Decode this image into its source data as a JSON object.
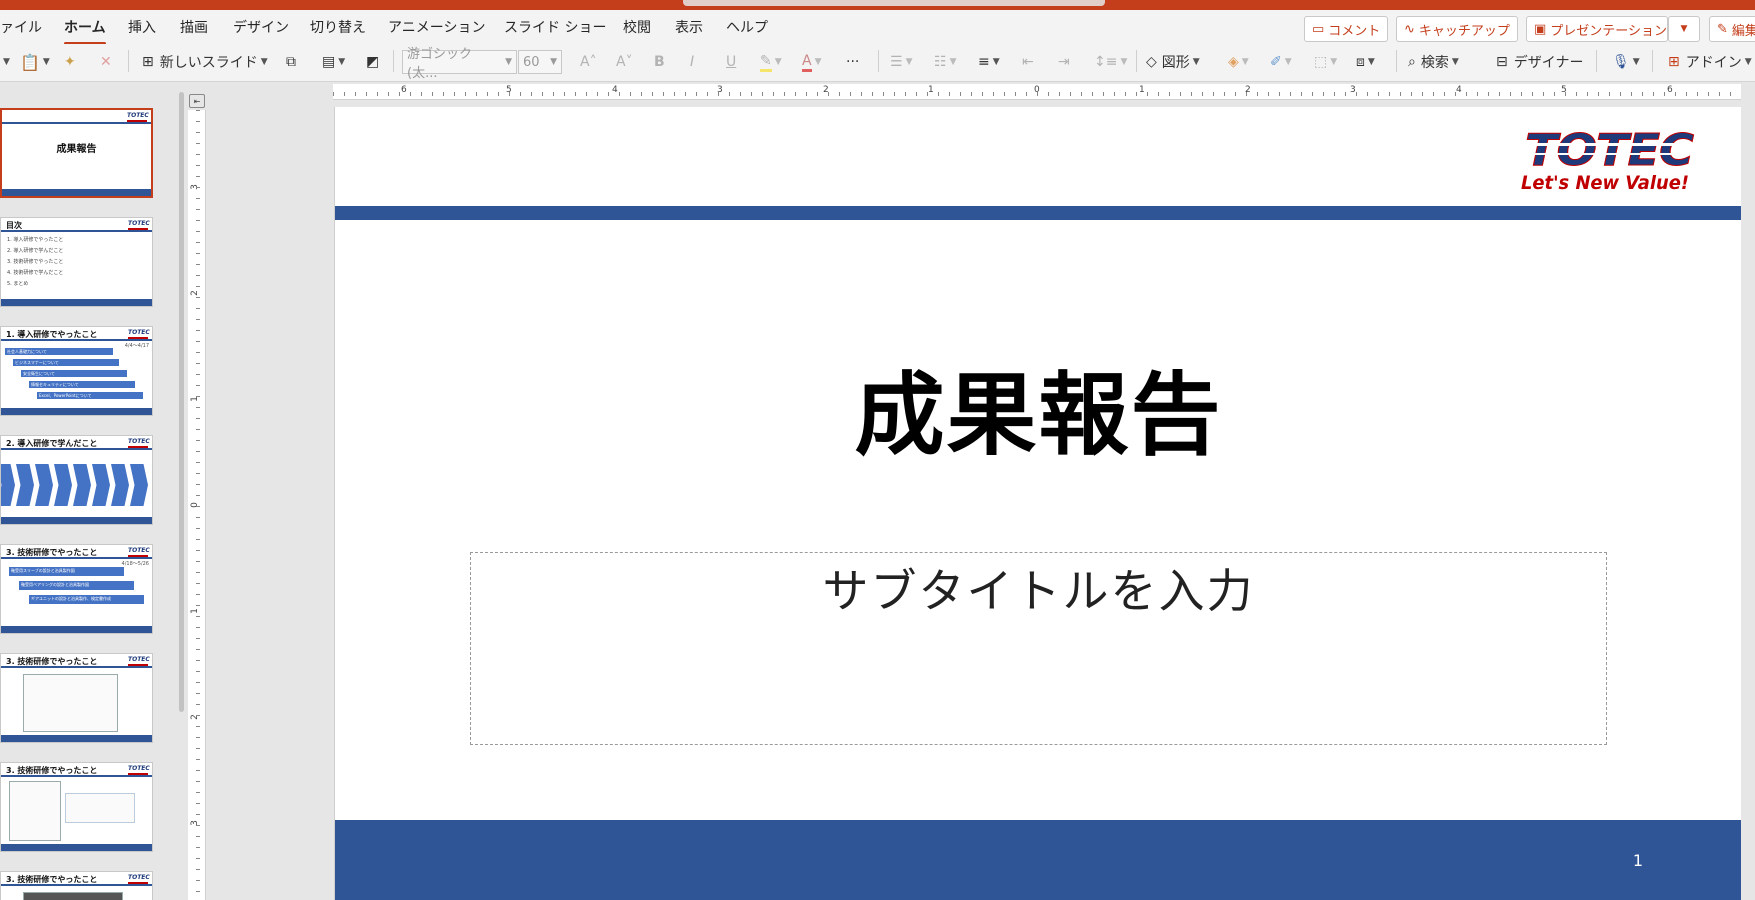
{
  "menu": {
    "tabs": [
      "ァイル",
      "ホーム",
      "挿入",
      "描画",
      "デザイン",
      "切り替え",
      "アニメーション",
      "スライド ショー",
      "校閲",
      "表示",
      "ヘルプ"
    ],
    "active_tab": "ホーム",
    "comment_label": "コメント",
    "catchup_label": "キャッチアップ",
    "present_label": "プレゼンテーション",
    "edit_label": "編集"
  },
  "ribbon": {
    "new_slide_label": "新しいスライド",
    "font_name": "游ゴシック (太...",
    "font_size": "60",
    "search_label": "検索",
    "shapes_label": "図形",
    "designer_label": "デザイナー",
    "addins_label": "アドイン",
    "more": "···"
  },
  "ruler": {
    "h_labels": [
      "6",
      "5",
      "4",
      "3",
      "2",
      "1",
      "0",
      "1",
      "2",
      "3",
      "4",
      "5",
      "6"
    ],
    "v_labels": [
      "3",
      "2",
      "1",
      "0",
      "1",
      "2",
      "3"
    ]
  },
  "slide": {
    "title": "成果報告",
    "subtitle_placeholder": "サブタイトルを入力",
    "page_number": "1",
    "logo_text": "TOTEC",
    "logo_tagline": "Let's New Value!"
  },
  "thumbnails": {
    "t1_title": "成果報告",
    "t2_title": "目次",
    "t2_items": [
      "1. 導入研修でやったこと",
      "2. 導入研修で学んだこと",
      "3. 技術研修でやったこと",
      "4. 技術研修で学んだこと",
      "5. まとめ"
    ],
    "t3_title": "1. 導入研修でやったこと",
    "t3_date": "4/4～4/17",
    "t3_items": [
      "社会人基礎力について",
      "ビジネスマナーについて",
      "安全衛生について",
      "情報セキュリティについて",
      "Excel、PowerPointについて"
    ],
    "t4_title": "2. 導入研修で学んだこと",
    "t4_items": [
      "社会人基礎力",
      "報連相",
      "挨拶",
      "身だしなみ",
      "時間は企業",
      "相手を意識",
      "5S活動",
      "資料の使い方"
    ],
    "t5_title": "3. 技術研修でやったこと",
    "t5_date": "4/18～5/26",
    "t5_items": [
      "軸受用スリーブの設計と治具製作図",
      "軸受用ベアリングの設計と治具製作図",
      "ギアユニットの設計と治具製作、検定書作成"
    ],
    "t6_title": "3. 技術研修でやったこと",
    "t7_title": "3. 技術研修でやったこと",
    "t8_title": "3. 技術研修でやったこと"
  },
  "colors": {
    "accent": "#c43e1c",
    "slide_band": "#2f5597",
    "logo_navy": "#1f3a7a",
    "logo_red": "#c00000"
  }
}
